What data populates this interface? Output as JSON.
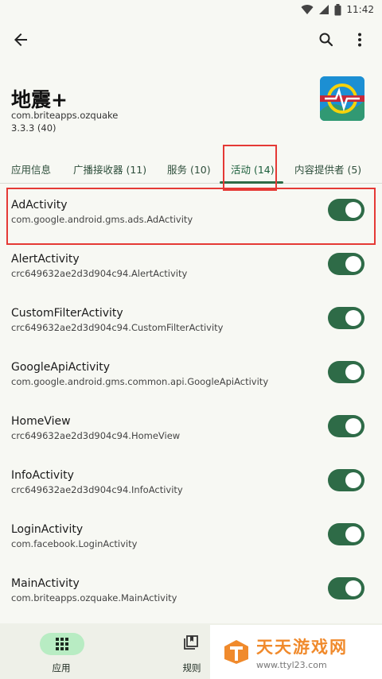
{
  "status_bar": {
    "time": "11:42"
  },
  "app": {
    "title": "地震+",
    "package": "com.briteapps.ozquake",
    "version": "3.3.3 (40)"
  },
  "tabs": [
    {
      "label": "应用信息"
    },
    {
      "label": "广播接收器 (11)"
    },
    {
      "label": "服务 (10)"
    },
    {
      "label": "活动 (14)"
    },
    {
      "label": "内容提供者 (5)"
    }
  ],
  "activities": [
    {
      "name": "AdActivity",
      "class": "com.google.android.gms.ads.AdActivity",
      "enabled": true
    },
    {
      "name": "AlertActivity",
      "class": "crc649632ae2d3d904c94.AlertActivity",
      "enabled": true
    },
    {
      "name": "CustomFilterActivity",
      "class": "crc649632ae2d3d904c94.CustomFilterActivity",
      "enabled": true
    },
    {
      "name": "GoogleApiActivity",
      "class": "com.google.android.gms.common.api.GoogleApiActivity",
      "enabled": true
    },
    {
      "name": "HomeView",
      "class": "crc649632ae2d3d904c94.HomeView",
      "enabled": true
    },
    {
      "name": "InfoActivity",
      "class": "crc649632ae2d3d904c94.InfoActivity",
      "enabled": true
    },
    {
      "name": "LoginActivity",
      "class": "com.facebook.LoginActivity",
      "enabled": true
    },
    {
      "name": "MainActivity",
      "class": "com.briteapps.ozquake.MainActivity",
      "enabled": true
    }
  ],
  "bottom_nav": {
    "apps_label": "应用",
    "rules_label": "规则"
  },
  "watermark": {
    "title": "天天游戏网",
    "url": "www.ttyl23.com"
  },
  "colors": {
    "accent": "#2e6b47",
    "highlight": "#e53935",
    "nav_pill": "#b8ecc3"
  }
}
